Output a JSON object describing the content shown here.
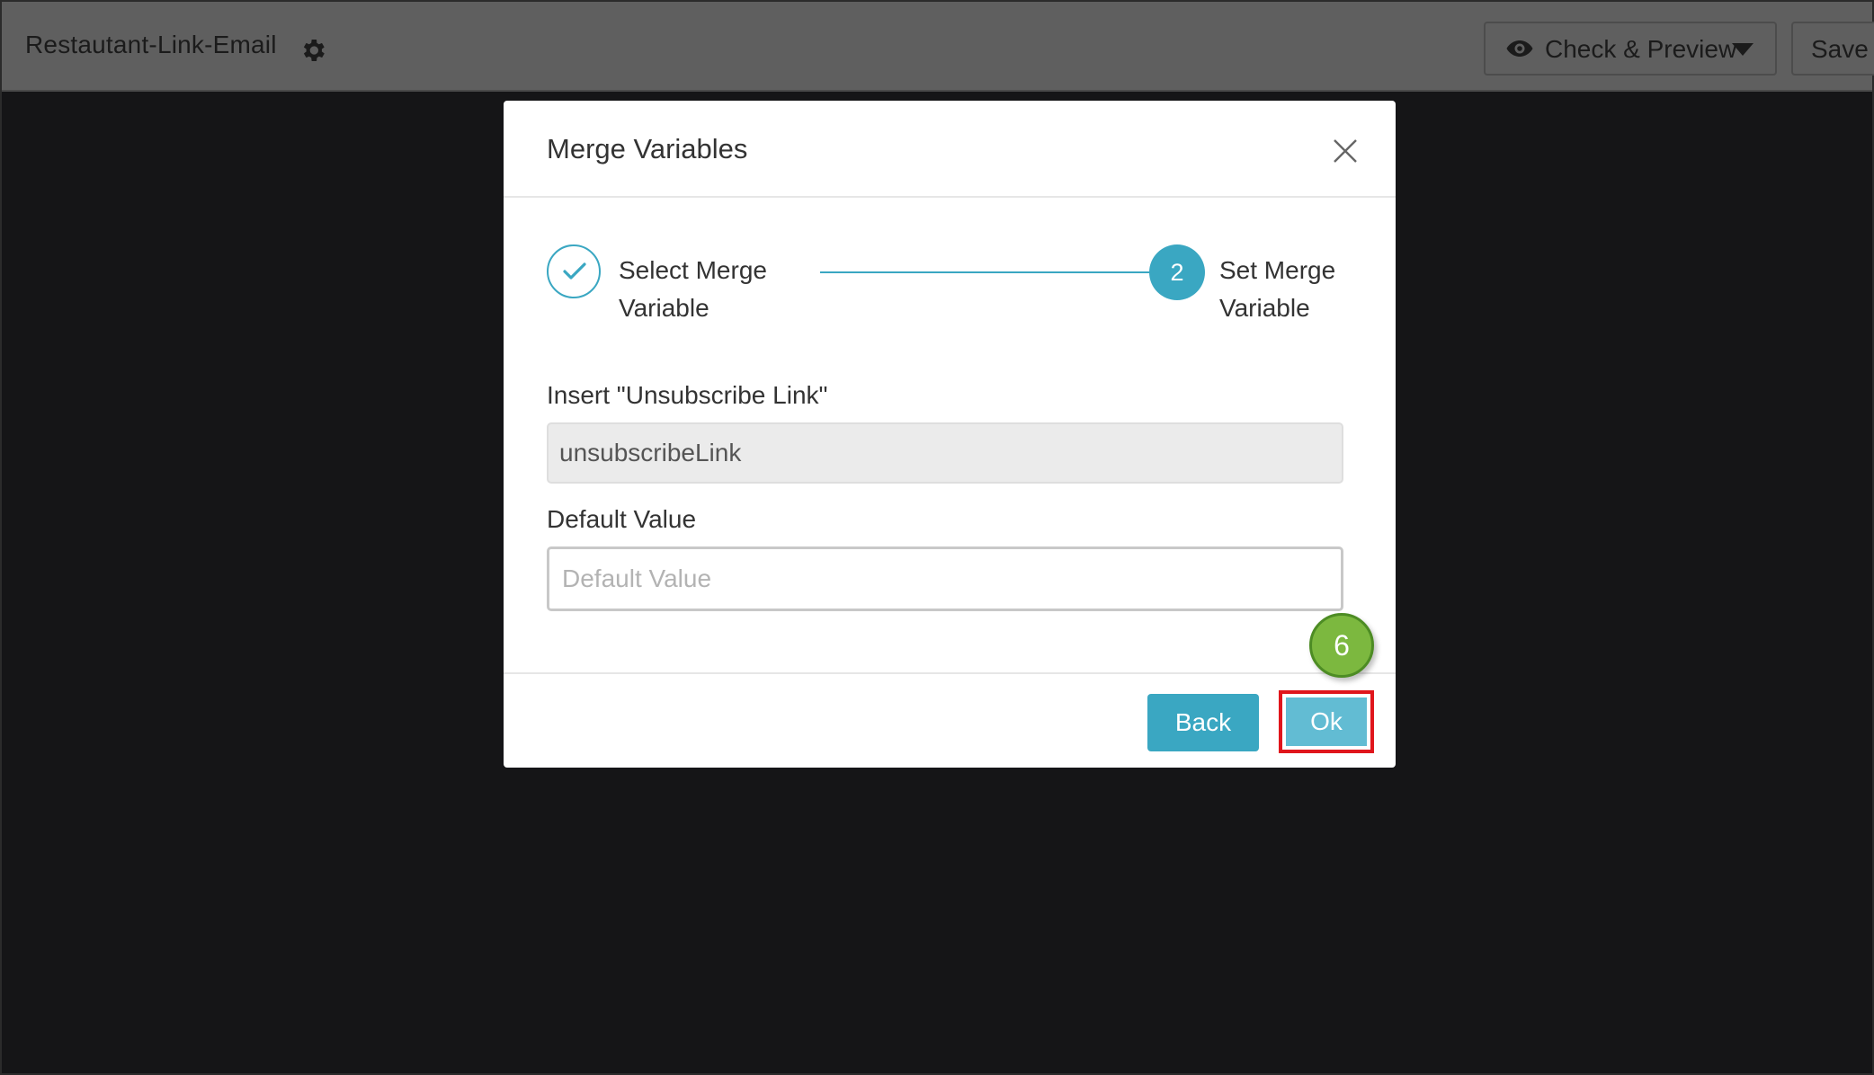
{
  "topbar": {
    "document_title": "Restautant-Link-Email",
    "settings_icon": "gear-icon",
    "preview_button": {
      "label": "Check & Preview",
      "icon": "eye-icon",
      "menu_icon": "caret-down-icon"
    },
    "save_button": {
      "label": "Save"
    }
  },
  "modal": {
    "title": "Merge Variables",
    "close_icon": "close-icon",
    "stepper": {
      "step1": {
        "label": "Select Merge Variable",
        "status": "completed",
        "icon": "check-icon"
      },
      "step2": {
        "number": "2",
        "label": "Set Merge Variable",
        "status": "active"
      }
    },
    "insert_label": "Insert \"Unsubscribe Link\"",
    "variable_value": "unsubscribeLink",
    "default_value_label": "Default Value",
    "default_value_input": {
      "value": "",
      "placeholder": "Default Value"
    },
    "buttons": {
      "back": "Back",
      "ok": "Ok"
    }
  },
  "annotation": {
    "step_number": "6",
    "highlight_color": "#e0161c",
    "badge_color": "#7cb83f"
  },
  "colors": {
    "accent": "#3aa7c2",
    "overlay": "#151517"
  }
}
